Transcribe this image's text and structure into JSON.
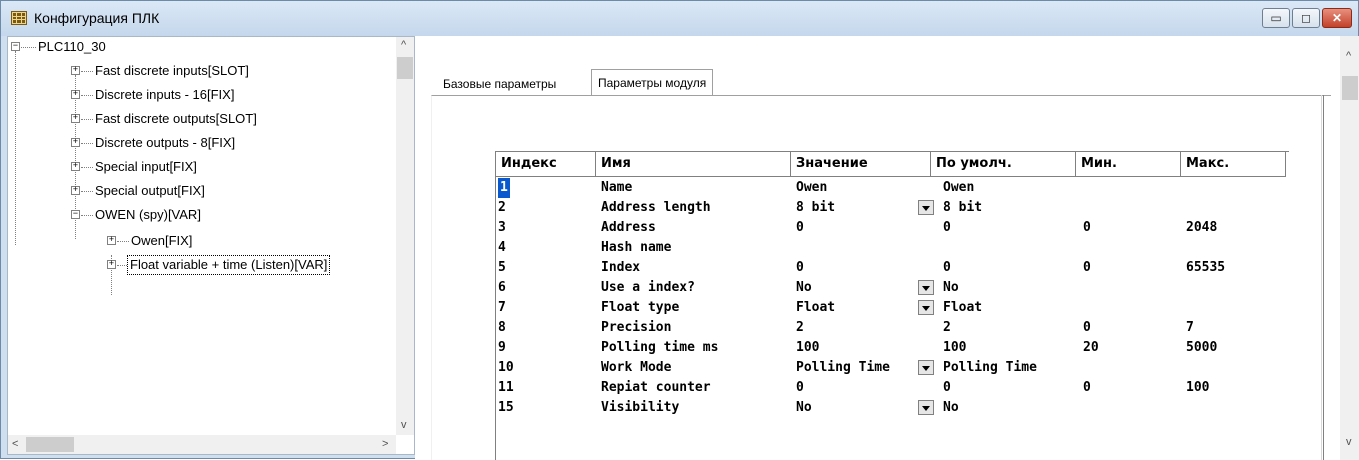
{
  "window": {
    "title": "Конфигурация ПЛК",
    "minimize_glyph": "▭",
    "maximize_glyph": "◻",
    "close_glyph": "✕"
  },
  "tree": {
    "root": "PLC110_30",
    "items": [
      {
        "label": "Fast discrete inputs[SLOT]",
        "toggle": "+"
      },
      {
        "label": "Discrete inputs - 16[FIX]",
        "toggle": "+"
      },
      {
        "label": "Fast discrete outputs[SLOT]",
        "toggle": "+"
      },
      {
        "label": "Discrete outputs - 8[FIX]",
        "toggle": "+"
      },
      {
        "label": "Special input[FIX]",
        "toggle": "+"
      },
      {
        "label": "Special output[FIX]",
        "toggle": "+"
      },
      {
        "label": "OWEN (spy)[VAR]",
        "toggle": "−"
      }
    ],
    "children": [
      {
        "label": "Owen[FIX]",
        "toggle": "+"
      },
      {
        "label": "Float variable + time (Listen)[VAR]",
        "toggle": "+"
      }
    ],
    "root_toggle": "−"
  },
  "tabs": [
    "Базовые параметры",
    "Параметры модуля"
  ],
  "active_tab": "Параметры модуля",
  "table": {
    "headers": [
      "Индекс",
      "Имя",
      "Значение",
      "По умолч.",
      "Мин.",
      "Макс."
    ],
    "rows": [
      {
        "index": "1",
        "name": "Name",
        "value": "Owen",
        "dropdown": false,
        "default": "Owen",
        "min": "",
        "max": ""
      },
      {
        "index": "2",
        "name": "Address length",
        "value": "8 bit",
        "dropdown": true,
        "default": "8 bit",
        "min": "",
        "max": ""
      },
      {
        "index": "3",
        "name": "Address",
        "value": "0",
        "dropdown": false,
        "default": "0",
        "min": "0",
        "max": "2048"
      },
      {
        "index": "4",
        "name": "Hash name",
        "value": "",
        "dropdown": false,
        "default": "",
        "min": "",
        "max": ""
      },
      {
        "index": "5",
        "name": "Index",
        "value": "0",
        "dropdown": false,
        "default": "0",
        "min": "0",
        "max": "65535"
      },
      {
        "index": "6",
        "name": "Use a index?",
        "value": "No",
        "dropdown": true,
        "default": "No",
        "min": "",
        "max": ""
      },
      {
        "index": "7",
        "name": "Float type",
        "value": "Float",
        "dropdown": true,
        "default": "Float",
        "min": "",
        "max": ""
      },
      {
        "index": "8",
        "name": "Precision",
        "value": "2",
        "dropdown": false,
        "default": "2",
        "min": "0",
        "max": "7"
      },
      {
        "index": "9",
        "name": "Polling time ms",
        "value": "100",
        "dropdown": false,
        "default": "100",
        "min": "20",
        "max": "5000"
      },
      {
        "index": "10",
        "name": "Work Mode",
        "value": "Polling Time",
        "dropdown": true,
        "default": "Polling Time",
        "min": "",
        "max": ""
      },
      {
        "index": "11",
        "name": "Repiat counter",
        "value": "0",
        "dropdown": false,
        "default": "0",
        "min": "0",
        "max": "100"
      },
      {
        "index": "15",
        "name": "Visibility",
        "value": "No",
        "dropdown": true,
        "default": "No",
        "min": "",
        "max": ""
      }
    ]
  },
  "colors": {
    "selection": "#0a58ce",
    "titlebar": "#cfdff0",
    "close_button": "#c2412a"
  },
  "icons": {
    "app": "plc-config-icon",
    "scroll_up": "▲",
    "scroll_down": "▼",
    "scroll_left": "◀",
    "scroll_right": "▶"
  },
  "scroll_glyphs": {
    "up": "^",
    "down": "v",
    "left": "<",
    "right": ">"
  }
}
